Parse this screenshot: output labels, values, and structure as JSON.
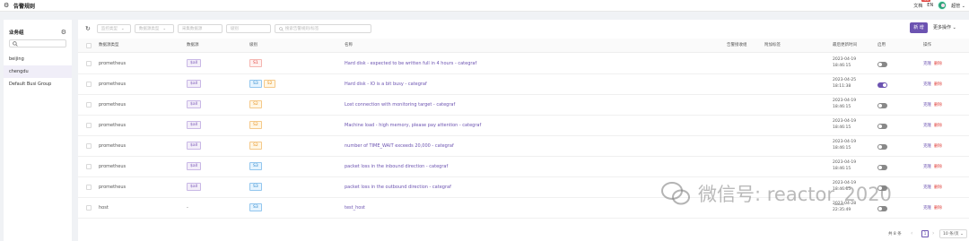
{
  "header": {
    "title": "告警规则",
    "docs": "文档",
    "docs_badge": "new",
    "lang": "EN",
    "user": "超管"
  },
  "sidebar": {
    "title": "业务组",
    "items": [
      "beijing",
      "chengdu",
      "Default Busi Group"
    ],
    "active": "chengdu"
  },
  "toolbar": {
    "filters": [
      "监控类型",
      "数据源类型",
      "采集数据源",
      "级别"
    ],
    "search_placeholder": "搜索告警规则/标签",
    "new_button": "新 增",
    "more_button": "更多操作"
  },
  "table": {
    "columns": [
      "数据源类型",
      "数据源",
      "级别",
      "名称",
      "告警接收组",
      "附加标签",
      "最后更新时间",
      "启用",
      "操作"
    ],
    "rows": [
      {
        "type": "prometheus",
        "datasource": "$all",
        "severity": [
          "S1"
        ],
        "name": "Hard disk - expected to be written full in 4 hours - categraf",
        "updated": [
          "2023-04-19",
          "18:46:15"
        ],
        "enabled": false
      },
      {
        "type": "prometheus",
        "datasource": "$all",
        "severity": [
          "S3",
          "S2"
        ],
        "name": "Hard disk - IO is a bit busy - categraf",
        "updated": [
          "2023-04-25",
          "18:11:38"
        ],
        "enabled": true
      },
      {
        "type": "prometheus",
        "datasource": "$all",
        "severity": [
          "S2"
        ],
        "name": "Lost connection with monitoring target - categraf",
        "updated": [
          "2023-04-19",
          "18:46:15"
        ],
        "enabled": false
      },
      {
        "type": "prometheus",
        "datasource": "$all",
        "severity": [
          "S2"
        ],
        "name": "Machine load - high memory, please pay attention - categraf",
        "updated": [
          "2023-04-19",
          "18:46:15"
        ],
        "enabled": false
      },
      {
        "type": "prometheus",
        "datasource": "$all",
        "severity": [
          "S2"
        ],
        "name": "number of TIME_WAIT exceeds 20,000 - categraf",
        "updated": [
          "2023-04-19",
          "18:46:15"
        ],
        "enabled": false
      },
      {
        "type": "prometheus",
        "datasource": "$all",
        "severity": [
          "S3"
        ],
        "name": "packet loss in the inbound direction - categraf",
        "updated": [
          "2023-04-19",
          "18:46:15"
        ],
        "enabled": false
      },
      {
        "type": "prometheus",
        "datasource": "$all",
        "severity": [
          "S3"
        ],
        "name": "packet loss in the outbound direction - categraf",
        "updated": [
          "2023-04-19",
          "18:46:15"
        ],
        "enabled": false
      },
      {
        "type": "host",
        "datasource": "-",
        "severity": [
          "S3"
        ],
        "name": "test_host",
        "updated": [
          "2023-04-28",
          "22:35:49"
        ],
        "enabled": false
      }
    ],
    "action_clone": "克隆",
    "action_delete": "删除"
  },
  "pagination": {
    "total": "共 8 条",
    "current_page": "1",
    "page_size": "10 条/页"
  },
  "watermark": "微信号: reactor_2020",
  "colors": {
    "primary": "#6c53b1",
    "danger": "#e0413c",
    "s1": "#e0413c",
    "s2": "#e89423",
    "s3": "#2b86c9"
  }
}
